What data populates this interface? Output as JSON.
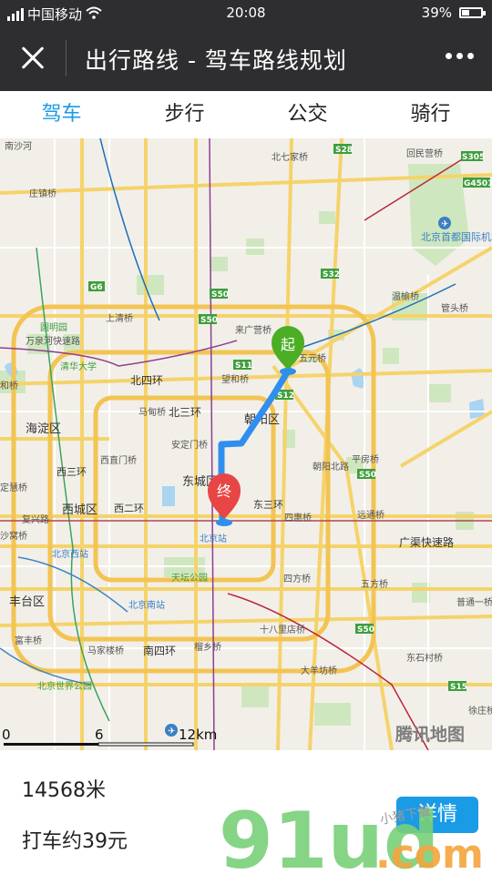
{
  "status_bar": {
    "carrier": "中国移动",
    "time": "20:08",
    "battery": "39%",
    "battery_level": 0.39
  },
  "nav": {
    "title": "出行路线 - 驾车路线规划"
  },
  "tabs": [
    {
      "label": "驾车",
      "active": true
    },
    {
      "label": "步行",
      "active": false
    },
    {
      "label": "公交",
      "active": false
    },
    {
      "label": "骑行",
      "active": false
    }
  ],
  "map": {
    "start_marker": "起",
    "end_marker": "终",
    "brand": "腾讯地图",
    "scale": {
      "zero": "0",
      "mid": "6",
      "end": "12km"
    },
    "highway_shields": [
      "S28",
      "S305",
      "G4501",
      "S32",
      "G6",
      "S50",
      "S11",
      "S12",
      "S50",
      "S50",
      "S50",
      "S15"
    ],
    "labels": {
      "nanshahe": "南沙河",
      "beiqijia": "北七家桥",
      "huiyuanying": "回民营桥",
      "zhuangzhaqiao": "庄镇桥",
      "capital_airport": "北京首都国际机场",
      "wenyu": "温榆桥",
      "guantou": "管头桥",
      "shangqing": "上清桥",
      "laiguangying": "来广营桥",
      "yuanmingyuan": "圆明园",
      "qinghua": "清华大学",
      "wanquanhe": "万泉河快速路",
      "beisihuan": "北四环",
      "wuyuan": "五元桥",
      "wanghe": "望和桥",
      "mati": "马甸桥",
      "beisanhuan": "北三环",
      "chaoyangqu": "朝阳区",
      "haidianqu": "海淀区",
      "anding": "安定门桥",
      "xizhi": "西直门桥",
      "dongcheng": "东城区",
      "chaoyangbeilu": "朝阳北路",
      "pingfang": "平房桥",
      "xisanhuan": "西三环",
      "xichengqu": "西城区",
      "xierhuan": "西二环",
      "fuxing": "复兴路",
      "dongsanhuan": "东三环",
      "sihui": "四惠桥",
      "yuanjin": "远通桥",
      "guangqu": "广渠快速路",
      "beijingzhan": "北京站",
      "beijingxizhan": "北京西站",
      "tiantan": "天坛公园",
      "sifang": "四方桥",
      "wufang": "五方桥",
      "fengtai": "丰台区",
      "beijingnanzhan": "北京南站",
      "shibali": "十八里店桥",
      "putong": "普通一桥",
      "fengfeng": "富丰桥",
      "majiabao": "马家楼桥",
      "nansihuan": "南四环",
      "liuxiang": "榴乡桥",
      "dongsheng": "东石村桥",
      "shijie": "北京世界公园",
      "dayangfang": "大羊坊桥",
      "xuguan": "徐庄桥",
      "lizeqiao": "定慧桥",
      "lihe": "和桥",
      "yuzhuang": "沙窝桥"
    }
  },
  "summary": {
    "distance": "14568米",
    "taxi_fare": "打车约39元",
    "detail_button": "详情"
  },
  "watermark": {
    "brand": "91ud",
    "suffix": ".com",
    "note": "小猪下载"
  },
  "colors": {
    "accent": "#1a9be6",
    "bar": "#2e2e30",
    "route": "#2f8ff0",
    "start_pin": "#4cae24",
    "end_pin": "#e84545"
  }
}
